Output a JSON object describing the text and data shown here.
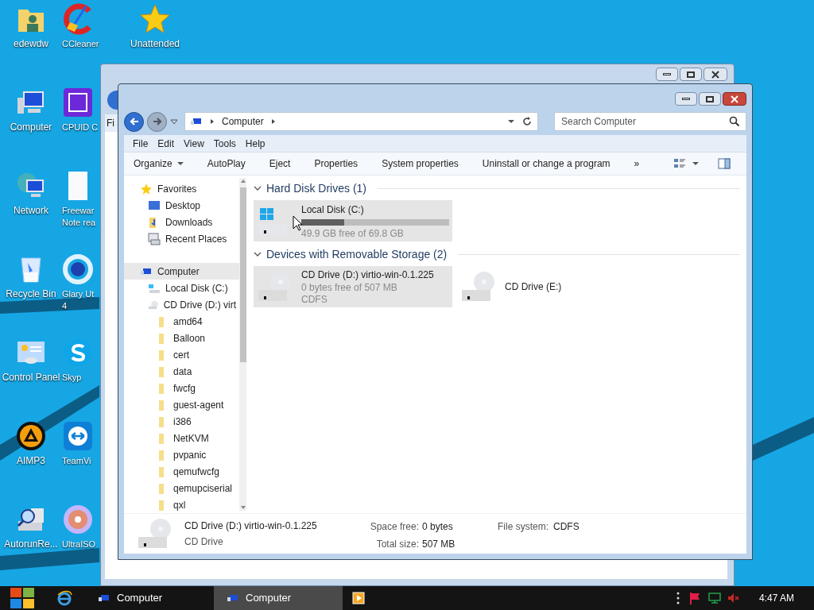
{
  "desktop_icons": [
    {
      "kind": "user-folder",
      "lines": [
        "edewdw"
      ]
    },
    {
      "kind": "computer",
      "lines": [
        "Computer"
      ]
    },
    {
      "kind": "network",
      "lines": [
        "Network"
      ]
    },
    {
      "kind": "bin",
      "lines": [
        "Recycle Bin"
      ]
    },
    {
      "kind": "panel",
      "lines": [
        "Control Panel"
      ]
    },
    {
      "kind": "triangle-app",
      "lines": [
        "AIMP3"
      ]
    },
    {
      "kind": "magnifier",
      "lines": [
        "AutorunRe..."
      ]
    },
    {
      "kind": "broom",
      "lines": [
        "CCleaner"
      ]
    },
    {
      "kind": "chip",
      "lines": [
        "CPUID C"
      ]
    },
    {
      "kind": "page",
      "lines": [
        "Freewar",
        "Note rea"
      ]
    },
    {
      "kind": "ring",
      "lines": [
        "Glary Ut",
        "4"
      ]
    },
    {
      "kind": "letter-app",
      "lines": [
        "Skyp"
      ]
    },
    {
      "kind": "arrows-app",
      "lines": [
        "TeamVi"
      ]
    },
    {
      "kind": "disc",
      "lines": [
        "UltraISO"
      ]
    },
    {
      "kind": "star",
      "lines": [
        "Unattended"
      ]
    }
  ],
  "back_window": {
    "menu_fragment": "Fi"
  },
  "window": {
    "address": [
      "Computer"
    ],
    "search": {
      "placeholder": "Search Computer"
    },
    "menu": [
      "File",
      "Edit",
      "View",
      "Tools",
      "Help"
    ],
    "toolbar": [
      {
        "label": "Organize",
        "dropdown": true
      },
      {
        "label": "AutoPlay",
        "dropdown": false
      },
      {
        "label": "Eject",
        "dropdown": false
      },
      {
        "label": "Properties",
        "dropdown": false
      },
      {
        "label": "System properties",
        "dropdown": false
      },
      {
        "label": "Uninstall or change a program",
        "dropdown": false
      },
      {
        "label": "»",
        "dropdown": false
      }
    ],
    "nav_tree": [
      {
        "label": "Favorites",
        "kind": "star",
        "selected": false,
        "children": [
          {
            "label": "Desktop",
            "kind": "desktop",
            "selected": false
          },
          {
            "label": "Downloads",
            "kind": "downloads",
            "selected": false
          },
          {
            "label": "Recent Places",
            "kind": "recent",
            "selected": false
          }
        ]
      },
      {
        "label": "Computer",
        "kind": "computer",
        "selected": true,
        "children": [
          {
            "label": "Local Disk (C:)",
            "kind": "disk",
            "selected": false
          },
          {
            "label": "CD Drive (D:) virt",
            "kind": "cd",
            "selected": false,
            "children": [
              {
                "label": "amd64",
                "kind": "folder",
                "selected": false
              },
              {
                "label": "Balloon",
                "kind": "folder",
                "selected": false
              },
              {
                "label": "cert",
                "kind": "folder",
                "selected": false
              },
              {
                "label": "data",
                "kind": "folder",
                "selected": false
              },
              {
                "label": "fwcfg",
                "kind": "folder",
                "selected": false
              },
              {
                "label": "guest-agent",
                "kind": "folder",
                "selected": false
              },
              {
                "label": "i386",
                "kind": "folder",
                "selected": false
              },
              {
                "label": "NetKVM",
                "kind": "folder",
                "selected": false
              },
              {
                "label": "pvpanic",
                "kind": "folder",
                "selected": false
              },
              {
                "label": "qemufwcfg",
                "kind": "folder",
                "selected": false
              },
              {
                "label": "qemupciserial",
                "kind": "folder",
                "selected": false
              },
              {
                "label": "qxl",
                "kind": "folder",
                "selected": false
              }
            ]
          }
        ]
      }
    ],
    "groups": [
      {
        "title": "Hard Disk Drives (1)",
        "items": [
          {
            "kind": "disk",
            "name": "Local Disk (C:)",
            "level": 0.29,
            "info": [
              "49.9 GB free of 69.8 GB"
            ],
            "selected": true
          }
        ]
      },
      {
        "title": "Devices with Removable Storage (2)",
        "items": [
          {
            "kind": "cd",
            "name": "CD Drive (D:) virtio-win-0.1.225",
            "info": [
              "0 bytes free of 507 MB",
              "CDFS"
            ],
            "selected": true
          },
          {
            "kind": "cd",
            "name": "CD Drive (E:)",
            "selected": false
          }
        ]
      }
    ],
    "details": {
      "title": "CD Drive (D:) virtio-win-0.1.225",
      "subtitle": "CD Drive",
      "fields": [
        {
          "label": "Space free:",
          "value": "0 bytes"
        },
        {
          "label": "Total size:",
          "value": "507 MB"
        },
        {
          "label": "File system:",
          "value": "CDFS"
        }
      ]
    }
  },
  "taskbar": {
    "tasks": [
      {
        "label": "Computer",
        "selected": false
      },
      {
        "label": "Computer",
        "selected": true
      }
    ],
    "clock": "4:47 AM"
  }
}
